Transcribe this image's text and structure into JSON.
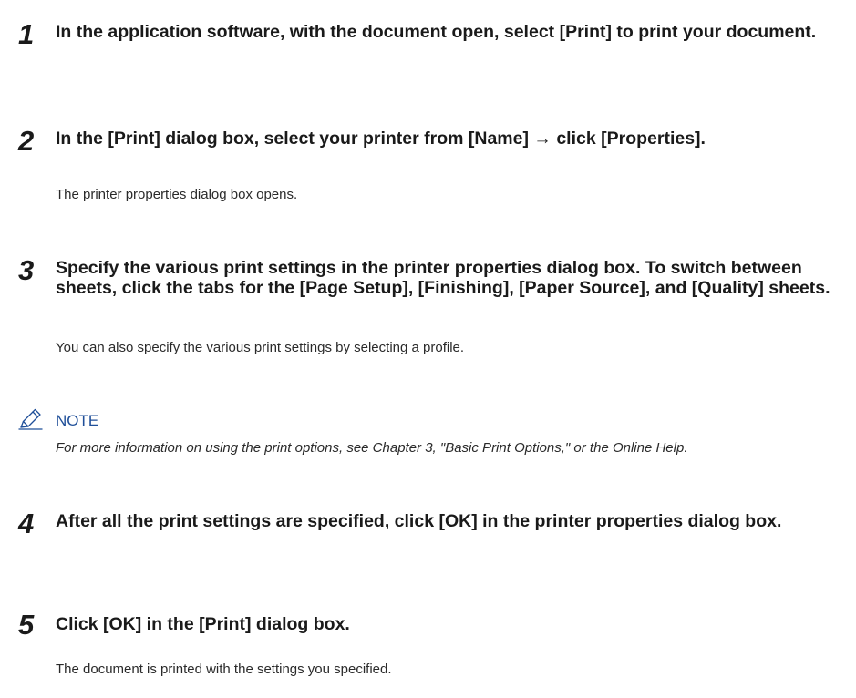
{
  "steps": [
    {
      "number": "1",
      "heading": "In the application software, with the document open, select [Print] to print your document."
    },
    {
      "number": "2",
      "heading": "In the [Print] dialog box, select your printer from [Name] → click [Properties].",
      "body": "The printer properties dialog box opens."
    },
    {
      "number": "3",
      "heading": "Specify the various print settings in the printer properties dialog box. To switch between sheets, click the tabs for the [Page Setup], [Finishing], [Paper Source], and [Quality] sheets.",
      "body": "You can also specify the various print settings by selecting a profile."
    },
    {
      "number": "4",
      "heading": "After all the print settings are specified, click [OK] in the printer properties dialog box."
    },
    {
      "number": "5",
      "heading": "Click [OK] in the [Print] dialog box.",
      "body": "The document is printed with the settings you specified."
    }
  ],
  "note": {
    "icon": "pencil-icon",
    "label": "NOTE",
    "text": "For more information on using the print options, see Chapter 3, \"Basic Print Options,\" or the Online Help."
  },
  "colors": {
    "note_label": "#1f4f99",
    "text": "#1a1a1a"
  }
}
